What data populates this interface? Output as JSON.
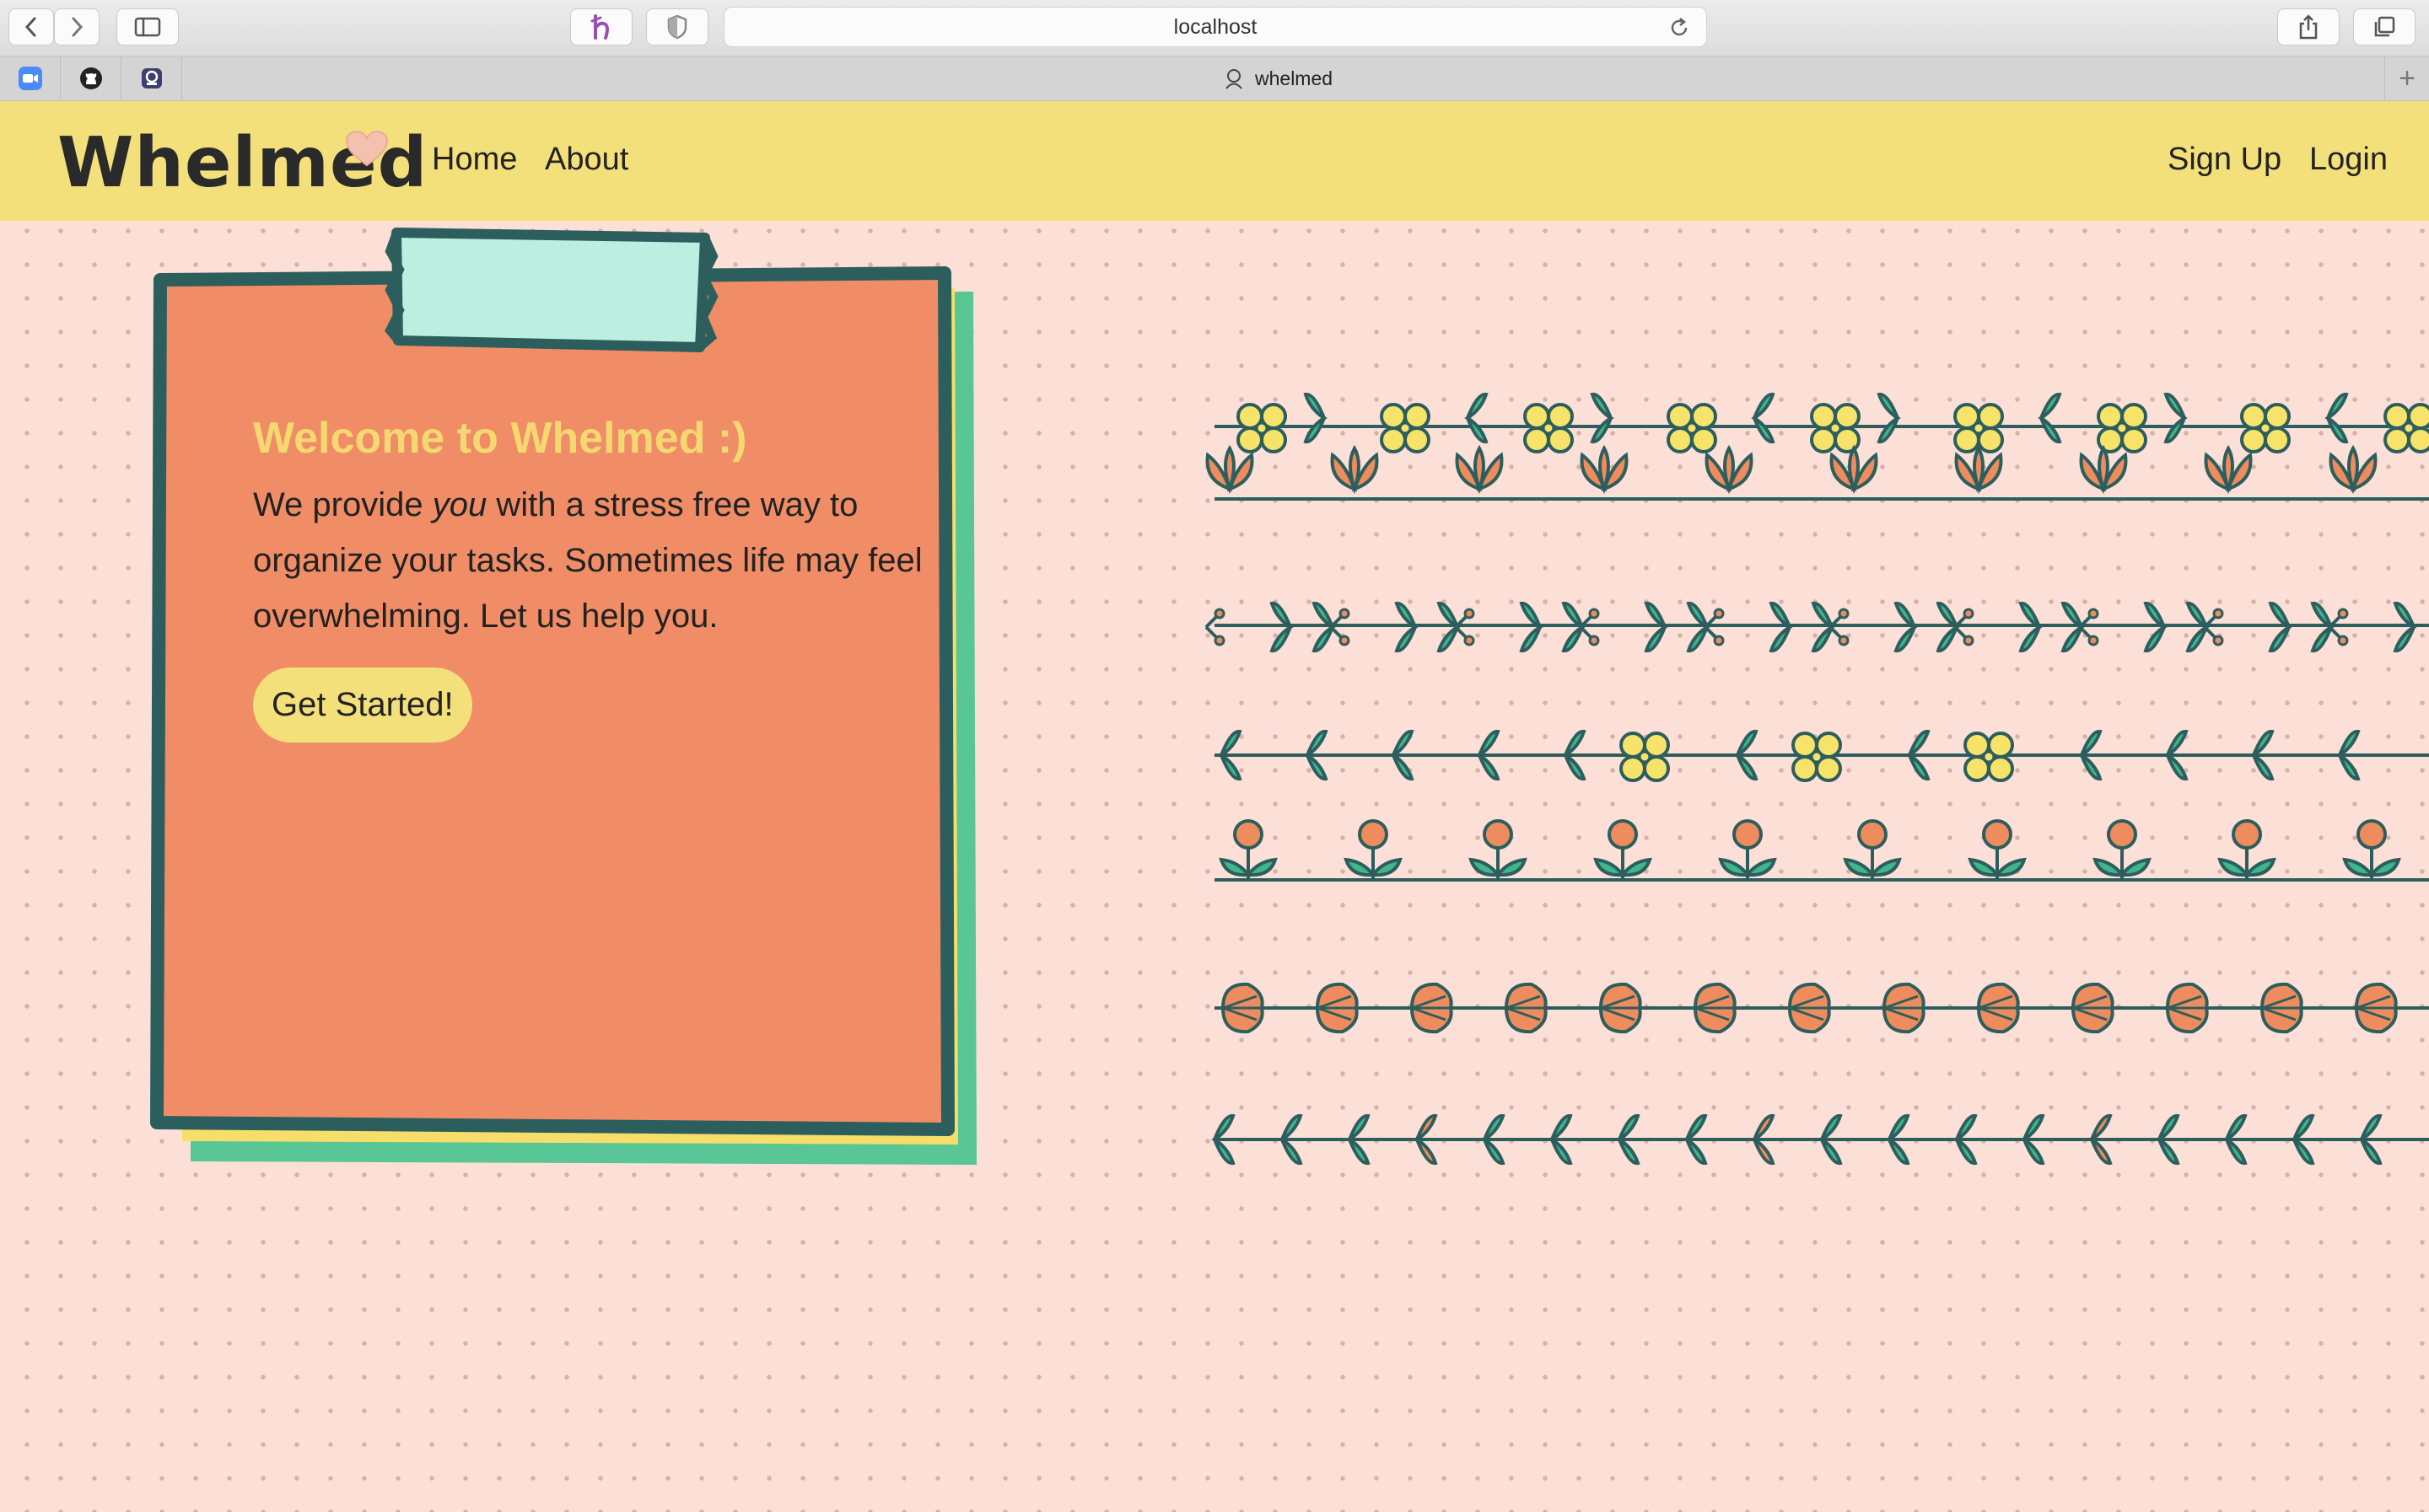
{
  "browser": {
    "url": "localhost",
    "tab_title": "whelmed",
    "new_tab_label": "+"
  },
  "header": {
    "logo": "Whelmed",
    "nav": {
      "home": "Home",
      "about": "About"
    },
    "auth": {
      "signup": "Sign Up",
      "login": "Login"
    }
  },
  "hero": {
    "title": "Welcome to Whelmed :)",
    "desc_before": "We provide ",
    "desc_emph": "you",
    "desc_after": " with a stress free way to organize your tasks. Sometimes life may feel overwhelming. Let us help you.",
    "cta": "Get Started!"
  },
  "colors": {
    "header_bg": "#f4e07b",
    "page_bg": "#fce0d8",
    "card_bg": "#f08d66",
    "card_border": "#2d5e5e",
    "tape": "#bdeee0",
    "accent_green": "#58c795",
    "accent_yellow": "#f7dd6a"
  },
  "icons": [
    "back-icon",
    "forward-icon",
    "sidebar-icon",
    "extension-h-icon",
    "shield-icon",
    "reload-icon",
    "share-icon",
    "tabs-icon",
    "heart-icon",
    "zoom-icon",
    "github-icon",
    "bookmark-icon"
  ]
}
